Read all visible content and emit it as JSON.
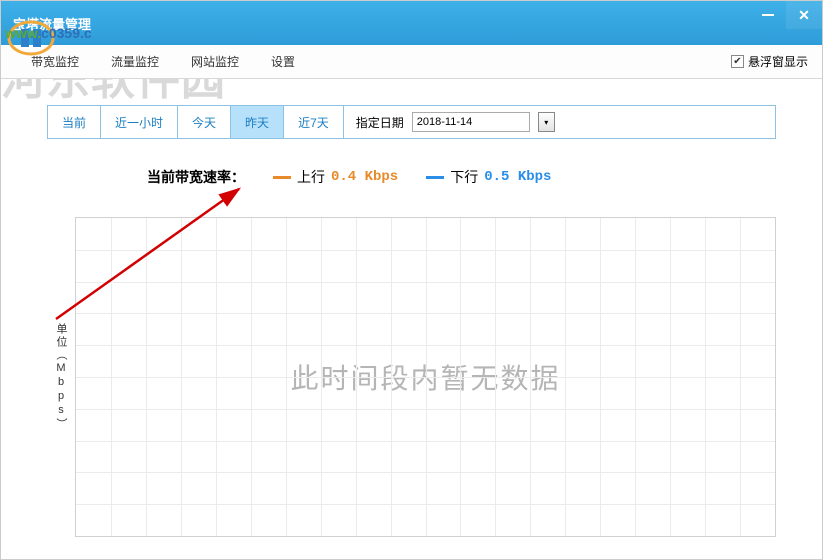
{
  "window": {
    "title": "宝塔流量管理"
  },
  "menu": {
    "items": [
      "带宽监控",
      "流量监控",
      "网站监控",
      "设置"
    ],
    "float_label": "悬浮窗显示",
    "float_checked": true
  },
  "tabs": {
    "items": [
      "当前",
      "近一小时",
      "今天",
      "昨天",
      "近7天"
    ],
    "selected_index": 3,
    "date_label": "指定日期",
    "date_value": "2018-11-14"
  },
  "rate": {
    "prefix": "当前带宽速率：",
    "up_label": "上行",
    "up_value": "0.4 Kbps",
    "down_label": "下行",
    "down_value": "0.5 Kbps"
  },
  "chart_data": {
    "type": "line",
    "title": "",
    "xlabel": "",
    "ylabel": "单位（Mbps）",
    "series": [
      {
        "name": "上行",
        "values": []
      },
      {
        "name": "下行",
        "values": []
      }
    ],
    "no_data_message": "此时间段内暂无数据"
  },
  "watermark": {
    "url_part1": "ww",
    "url_part2": "w.",
    "url_part3": "c0359.",
    "url_part4": "c",
    "text2": "河东软件园"
  }
}
